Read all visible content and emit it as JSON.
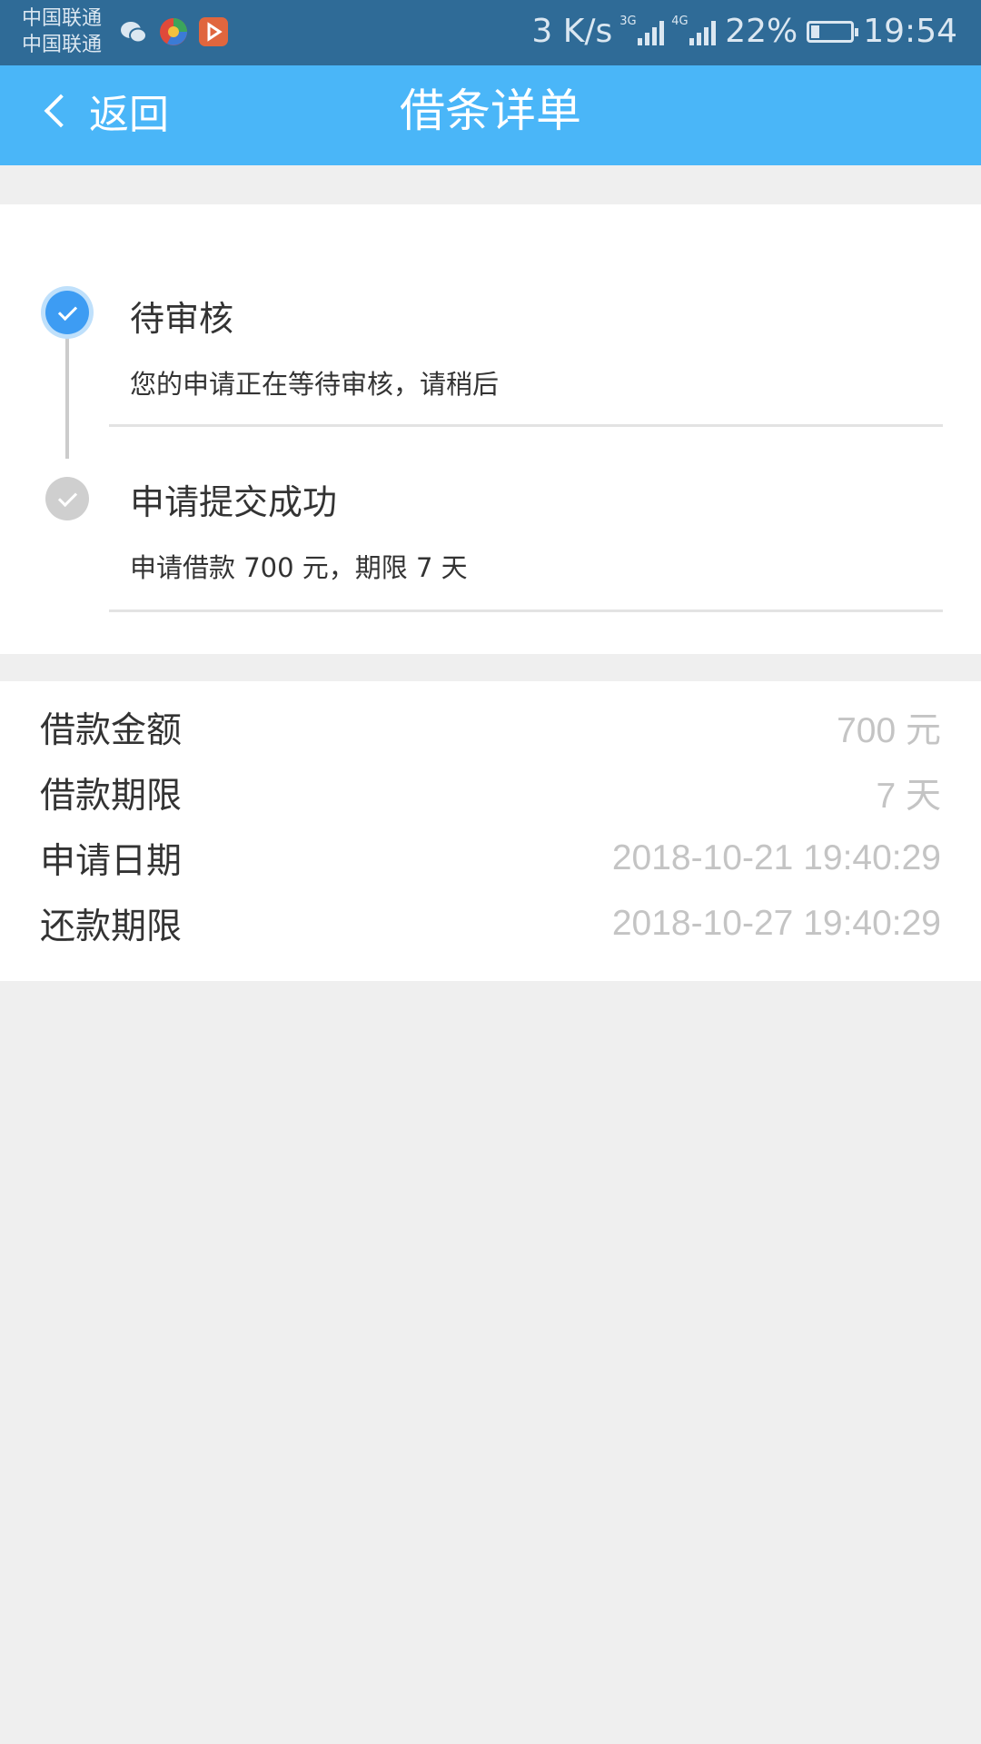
{
  "status_bar": {
    "carrier_1": "中国联通",
    "carrier_2": "中国联通",
    "apps": [
      "wechat-icon",
      "browser-icon",
      "video-app-icon"
    ],
    "speed": "3 K/s",
    "network_1": "3G",
    "network_2": "4G",
    "battery": "22%",
    "battery_level": 0.22,
    "time": "19:54"
  },
  "header": {
    "back_label": "返回",
    "title": "借条详单",
    "color": "#4ab6f8"
  },
  "timeline": [
    {
      "title": "待审核",
      "desc": "您的申请正在等待审核，请稍后",
      "state": "active"
    },
    {
      "title": "申请提交成功",
      "desc": "申请借款 700 元，期限 7 天",
      "state": "done"
    }
  ],
  "details": [
    {
      "label": "借款金额",
      "value": "700 元"
    },
    {
      "label": "借款期限",
      "value": "7 天"
    },
    {
      "label": "申请日期",
      "value": "2018-10-21 19:40:29"
    },
    {
      "label": "还款期限",
      "value": "2018-10-27 19:40:29"
    }
  ]
}
